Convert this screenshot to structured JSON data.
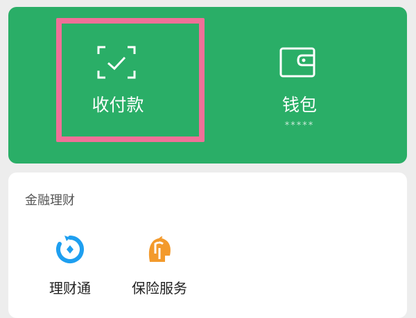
{
  "top_actions": {
    "pay": {
      "label": "收付款",
      "icon": "scan-check-icon"
    },
    "wallet": {
      "label": "钱包",
      "balance_masked": "*****",
      "icon": "wallet-icon"
    }
  },
  "finance": {
    "title": "金融理财",
    "items": [
      {
        "label": "理财通",
        "icon": "licaitong-icon",
        "color": "#1e9ff0"
      },
      {
        "label": "保险服务",
        "icon": "insurance-icon",
        "color": "#f39a2c"
      }
    ]
  },
  "colors": {
    "brand_green": "#2aae67",
    "highlight_pink": "#f07098",
    "background": "#ededed"
  }
}
